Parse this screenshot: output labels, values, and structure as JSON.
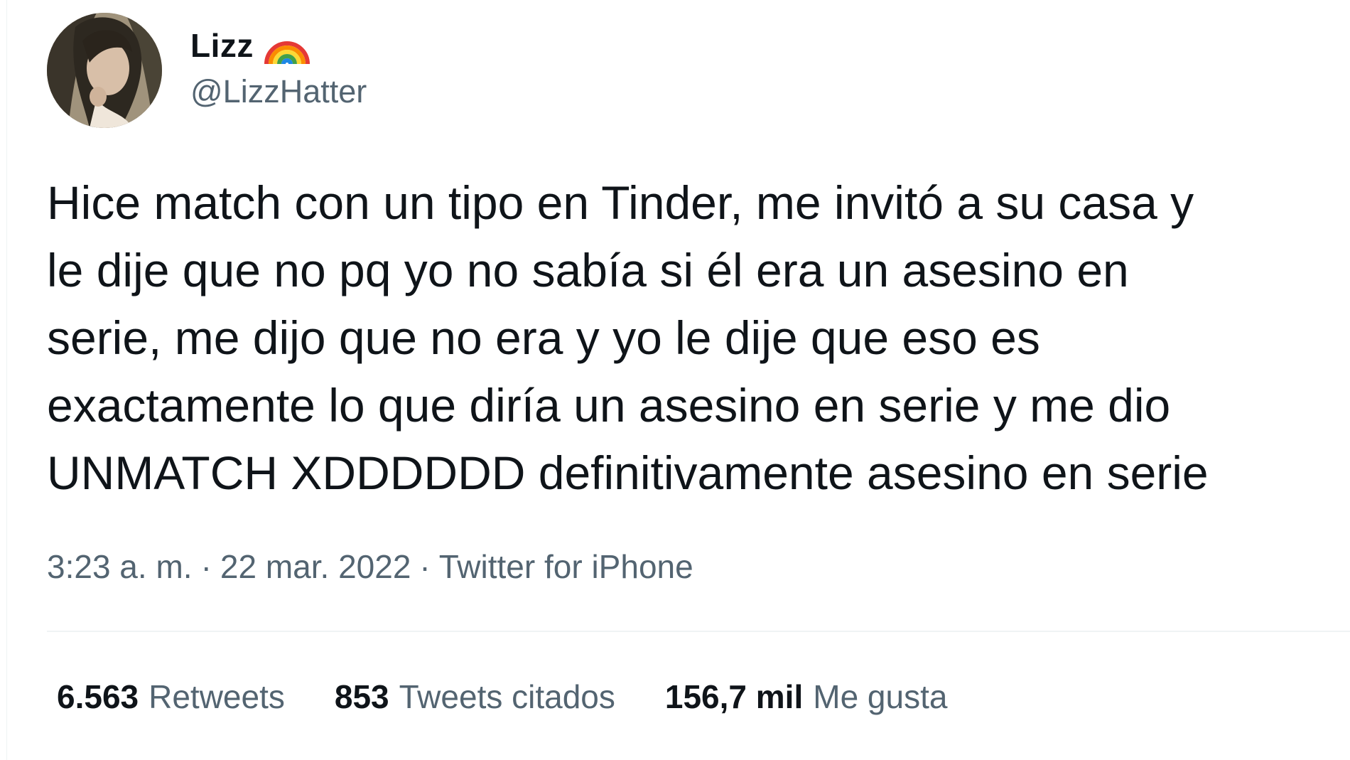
{
  "author": {
    "display_name": "Lizz",
    "name_emoji": "rainbow-emoji",
    "handle": "@LizzHatter",
    "avatar": "profile-photo"
  },
  "tweet": {
    "lines": [
      "Hice match con un tipo en Tinder, me invitó a su casa y",
      "le dije que no pq yo no sabía si él era un asesino en",
      "serie, me dijo que no era y yo le dije que eso es",
      "exactamente lo que diría un asesino en serie y me dio",
      "UNMATCH XDDDDDD definitivamente asesino en serie"
    ]
  },
  "meta": {
    "time": "3:23 a. m.",
    "separator": "·",
    "date": "22 mar. 2022",
    "source": "Twitter for iPhone"
  },
  "stats": [
    {
      "count": "6.563",
      "label": "Retweets"
    },
    {
      "count": "853",
      "label": "Tweets citados"
    },
    {
      "count": "156,7 mil",
      "label": "Me gusta"
    }
  ],
  "colors": {
    "primary_text": "#0f1419",
    "secondary_text": "#536471",
    "divider": "#eff3f4"
  }
}
